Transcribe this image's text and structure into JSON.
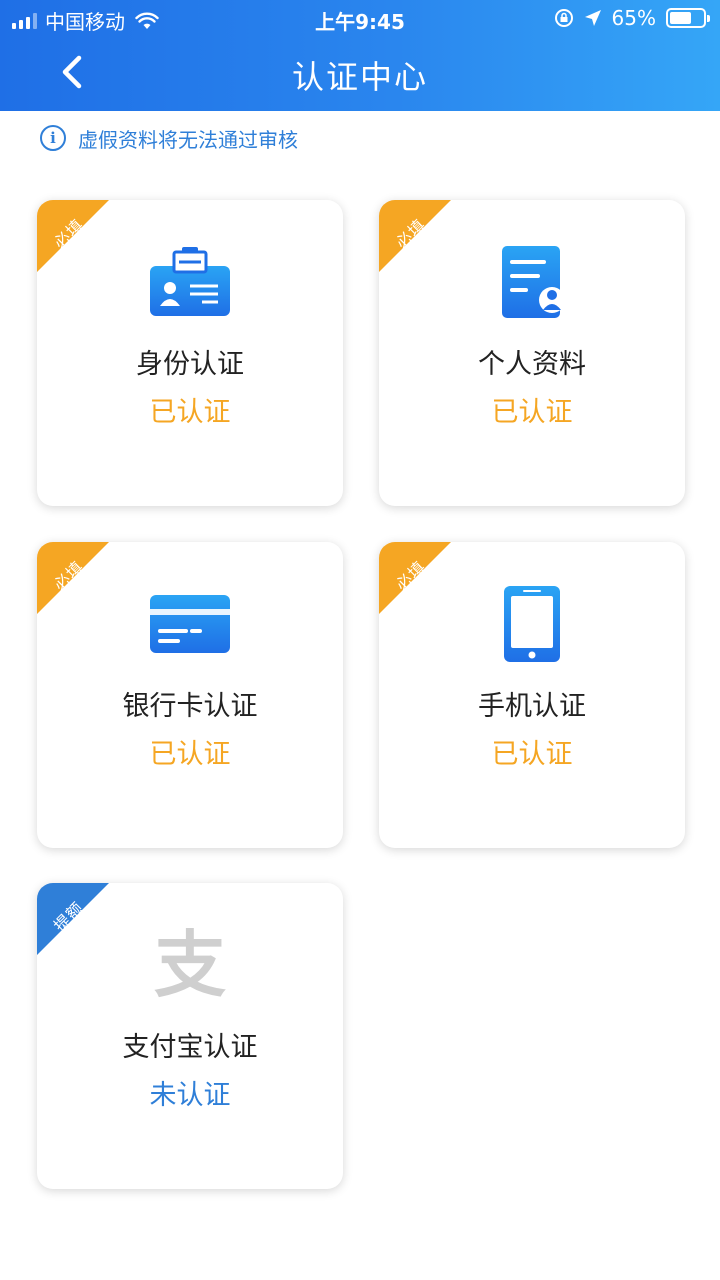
{
  "status_bar": {
    "carrier": "中国移动",
    "time": "上午9:45",
    "battery": "65%",
    "battery_level": 0.65
  },
  "nav": {
    "title": "认证中心",
    "back_icon": "chevron-left-icon"
  },
  "notice": {
    "icon": "info-icon",
    "icon_glyph": "i",
    "text": "虚假资料将无法通过审核"
  },
  "colors": {
    "header_start": "#1f6fe6",
    "header_end": "#35a6f7",
    "tag_required": "#f5a623",
    "tag_limit": "#2f7fd8",
    "status_done": "#f5a623",
    "status_pending": "#2f7fd8"
  },
  "cards": [
    {
      "tag": "必填",
      "title": "身份认证",
      "status": "已认证",
      "icon": "id-card-icon"
    },
    {
      "tag": "必填",
      "title": "个人资料",
      "status": "已认证",
      "icon": "profile-document-icon"
    },
    {
      "tag": "必填",
      "title": "银行卡认证",
      "status": "已认证",
      "icon": "bank-card-icon"
    },
    {
      "tag": "必填",
      "title": "手机认证",
      "status": "已认证",
      "icon": "mobile-phone-icon"
    },
    {
      "tag": "提额",
      "title": "支付宝认证",
      "status": "未认证",
      "icon": "alipay-icon",
      "icon_glyph": "支"
    }
  ]
}
